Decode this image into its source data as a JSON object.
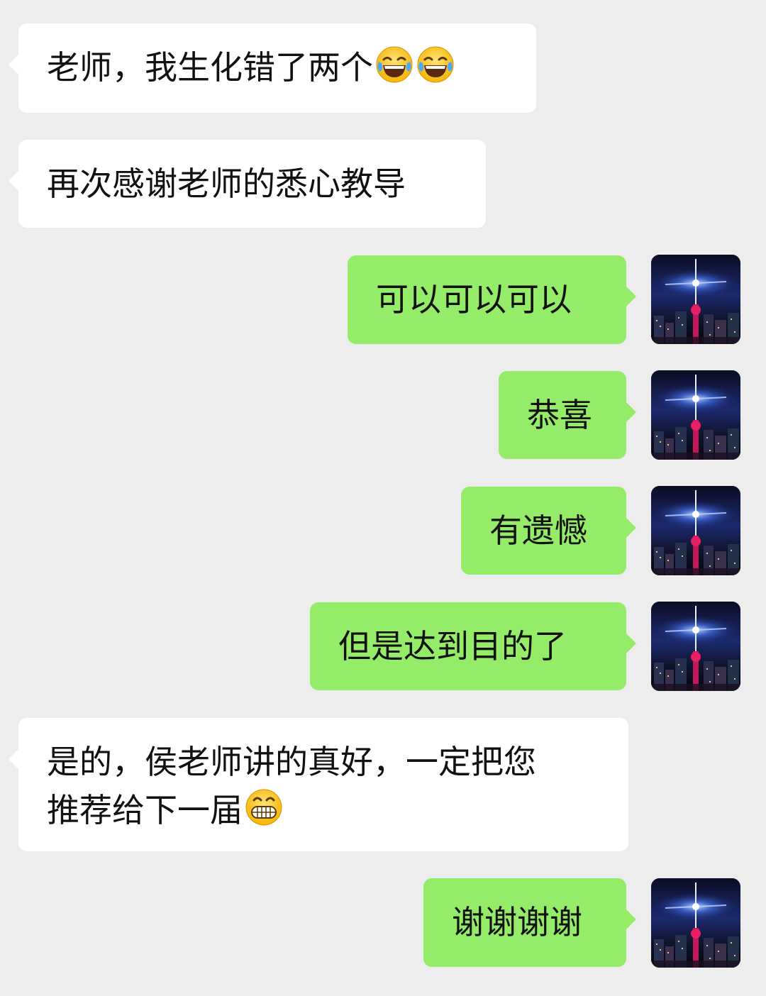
{
  "messages": [
    {
      "side": "in",
      "text": "老师，我生化错了两个",
      "emojis": [
        "tears-of-joy-emoji",
        "tears-of-joy-emoji"
      ]
    },
    {
      "side": "in",
      "text": "再次感谢老师的悉心教导"
    },
    {
      "side": "out",
      "text": "可以可以可以"
    },
    {
      "side": "out",
      "text": "恭喜"
    },
    {
      "side": "out",
      "text": "有遗憾"
    },
    {
      "side": "out",
      "text": "但是达到目的了"
    },
    {
      "side": "in",
      "line1": "是的，侯老师讲的真好，一定把您",
      "line2": "推荐给下一届",
      "emojis": [
        "grinning-emoji"
      ]
    },
    {
      "side": "out",
      "text": "谢谢谢谢"
    }
  ],
  "colors": {
    "background": "#ededed",
    "incoming_bubble": "#ffffff",
    "outgoing_bubble": "#95ec69"
  },
  "avatar": "city-night-tower-avatar"
}
